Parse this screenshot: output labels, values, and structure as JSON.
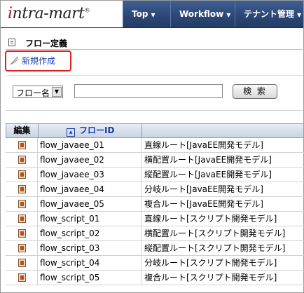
{
  "header": {
    "logo_text": "intra-mart",
    "nav": [
      {
        "label": "Top"
      },
      {
        "label": "Workflow"
      },
      {
        "label": "テナント管理"
      }
    ],
    "caret": "▼"
  },
  "section": {
    "title": "フロー定義"
  },
  "actions": {
    "new_label": "新規作成"
  },
  "search": {
    "field_select": "フロー名",
    "field_value": "",
    "button_label": "検 索"
  },
  "table": {
    "headers": {
      "edit": "編集",
      "flow_id": "フローID",
      "flow_name": ""
    },
    "rows": [
      {
        "id": "flow_javaee_01",
        "name": "直線ルート[JavaEE開発モデル]"
      },
      {
        "id": "flow_javaee_02",
        "name": "横配置ルート[JavaEE開発モデル]"
      },
      {
        "id": "flow_javaee_03",
        "name": "縦配置ルート[JavaEE開発モデル]"
      },
      {
        "id": "flow_javaee_04",
        "name": "分岐ルート[JavaEE開発モデル]"
      },
      {
        "id": "flow_javaee_05",
        "name": "複合ルート[JavaEE開発モデル]"
      },
      {
        "id": "flow_script_01",
        "name": "直線ルート[スクリプト開発モデル]"
      },
      {
        "id": "flow_script_02",
        "name": "横配置ルート[スクリプト開発モデル]"
      },
      {
        "id": "flow_script_03",
        "name": "縦配置ルート[スクリプト開発モデル]"
      },
      {
        "id": "flow_script_04",
        "name": "分岐ルート[スクリプト開発モデル]"
      },
      {
        "id": "flow_script_05",
        "name": "複合ルート[スクリプト開発モデル]"
      }
    ]
  },
  "colors": {
    "header_bg": "#2c4675",
    "link": "#1a3aa8",
    "highlight": "#e02020"
  },
  "icons": {
    "page": "document-icon",
    "new": "feather-icon",
    "sort": "sort-up-icon",
    "edit": "edit-icon"
  }
}
